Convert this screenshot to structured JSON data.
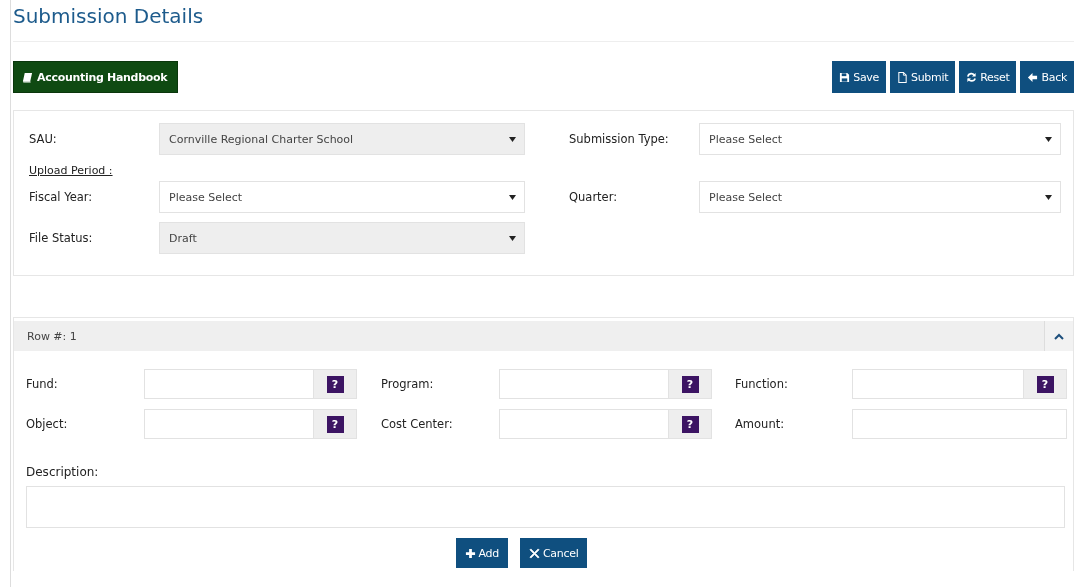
{
  "page": {
    "title": "Submission Details"
  },
  "toolbar": {
    "handbook": {
      "label": "Accounting Handbook"
    },
    "buttons": [
      {
        "kind": "save",
        "label": "Save"
      },
      {
        "kind": "submit",
        "label": "Submit"
      },
      {
        "kind": "reset",
        "label": "Reset"
      },
      {
        "kind": "back",
        "label": "Back"
      }
    ]
  },
  "filters": {
    "rows": [
      [
        {
          "label": "SAU:",
          "value": "Cornville Regional Charter School",
          "disabled": true
        },
        {
          "label": "Submission Type:",
          "value": "Please Select",
          "disabled": false
        }
      ],
      {
        "kind": "heading",
        "label": "Upload Period :"
      },
      [
        {
          "label": "Fiscal Year:",
          "value": "Please Select",
          "disabled": false
        },
        {
          "label": "Quarter:",
          "value": "Please Select",
          "disabled": false
        }
      ],
      [
        {
          "label": "File Status:",
          "value": "Draft",
          "disabled": true
        }
      ]
    ]
  },
  "row_panel": {
    "header": {
      "label": "Row #:",
      "number": "1",
      "expanded": true
    },
    "fields": [
      {
        "label": "Fund:",
        "kind": "lookup",
        "help": "?"
      },
      {
        "label": "Program:",
        "kind": "lookup",
        "help": "?"
      },
      {
        "label": "Function:",
        "kind": "lookup",
        "help": "?"
      },
      {
        "label": "Object:",
        "kind": "lookup",
        "help": "?"
      },
      {
        "label": "Cost Center:",
        "kind": "lookup",
        "help": "?"
      },
      {
        "label": "Amount:",
        "kind": "plain"
      }
    ],
    "description": {
      "label": "Description:"
    },
    "actions": [
      {
        "kind": "add",
        "label": "Add"
      },
      {
        "kind": "cancel",
        "label": "Cancel"
      }
    ]
  }
}
